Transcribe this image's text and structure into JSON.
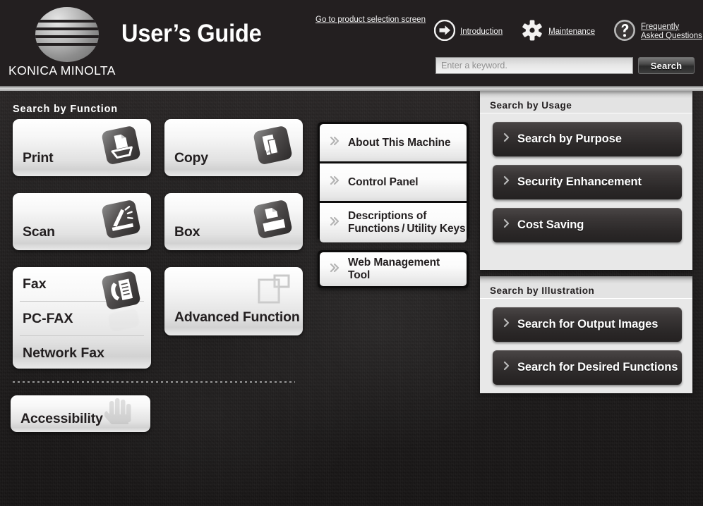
{
  "header": {
    "brand": "KONICA MINOLTA",
    "logo_icon": "konica-minolta-globe-logo",
    "title": "User’s Guide",
    "product_link": "Go to product selection screen",
    "nav": [
      {
        "label": "Introduction",
        "icon": "arrow-right-circle-icon"
      },
      {
        "label": "Maintenance",
        "icon": "gear-icon"
      },
      {
        "label": "Frequently\nAsked Questions",
        "label_line1": "Frequently",
        "label_line2": "Asked Questions",
        "icon": "question-mark-circle-icon"
      }
    ],
    "search": {
      "placeholder": "Enter a keyword.",
      "value": "",
      "button_label": "Search"
    }
  },
  "function_section": {
    "title": "Search by Function",
    "cards": [
      {
        "label": "Print",
        "icon": "printer-icon"
      },
      {
        "label": "Copy",
        "icon": "copy-icon"
      },
      {
        "label": "Scan",
        "icon": "scanner-icon"
      },
      {
        "label": "Box",
        "icon": "box-storage-icon"
      },
      {
        "label": "Advanced Function",
        "icon": "advanced-function-icon"
      },
      {
        "label": "Accessibility",
        "icon": "hand-icon"
      }
    ],
    "fax_group": {
      "icon": "fax-icon",
      "rows": [
        "Fax",
        "PC-FAX",
        "Network Fax"
      ]
    }
  },
  "middle_column": {
    "group_1": [
      {
        "label": "About This Machine",
        "icon": "double-chevron-right-icon"
      },
      {
        "label": "Control Panel",
        "icon": "double-chevron-right-icon"
      },
      {
        "label_line1": "Descriptions of",
        "label_line2": "Functions / Utility Keys",
        "icon": "double-chevron-right-icon"
      }
    ],
    "group_2": [
      {
        "label_line1": "Web Management",
        "label_line2": "Tool",
        "icon": "double-chevron-right-icon"
      }
    ]
  },
  "sidebar": {
    "usage_panel": {
      "title": "Search by Usage",
      "buttons": [
        {
          "label": "Search by Purpose",
          "icon": "chevron-right-icon"
        },
        {
          "label": "Security Enhancement",
          "icon": "chevron-right-icon"
        },
        {
          "label": "Cost Saving",
          "icon": "chevron-right-icon"
        }
      ]
    },
    "illustration_panel": {
      "title": "Search by Illustration",
      "buttons": [
        {
          "label": "Search for Output Images",
          "icon": "chevron-right-icon"
        },
        {
          "label": "Search for Desired Functions",
          "icon": "chevron-right-icon"
        }
      ]
    }
  },
  "colors": {
    "header_bg": "#231f20",
    "page_bg": "#201e1e",
    "panel_bg": "#e8e8e8",
    "card_face": "#f7f7f7",
    "dark_button": "#2b2828",
    "text_dark": "#231f20",
    "text_light": "#ffffff"
  }
}
